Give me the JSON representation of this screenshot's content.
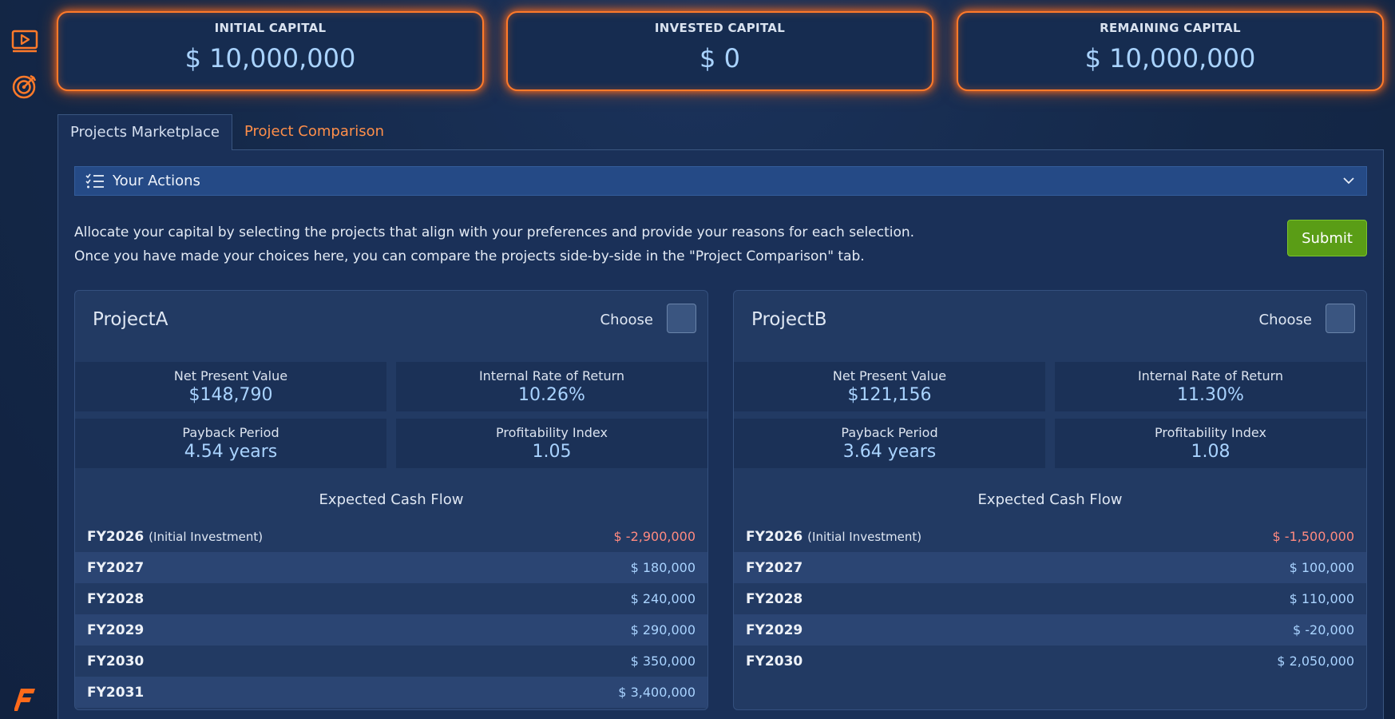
{
  "sidebar": {
    "icons": [
      "play-video-icon",
      "target-icon"
    ],
    "logo_icon": "brand-logo-icon"
  },
  "capital": {
    "initial": {
      "label": "INITIAL CAPITAL",
      "value": "$ 10,000,000"
    },
    "invested": {
      "label": "INVESTED CAPITAL",
      "value": "$ 0"
    },
    "remaining": {
      "label": "REMAINING CAPITAL",
      "value": "$ 10,000,000"
    }
  },
  "tabs": [
    {
      "label": "Projects Marketplace",
      "active": true
    },
    {
      "label": "Project Comparison",
      "active": false
    }
  ],
  "actions": {
    "label": "Your Actions",
    "icon": "checklist-icon",
    "toggle_icon": "chevron-down-icon"
  },
  "instructions": {
    "line1": "Allocate your capital by selecting the projects that align with your preferences and provide your reasons for each selection.",
    "line2": "Once you have made your choices here, you can compare the projects side-by-side in the \"Project Comparison\" tab."
  },
  "submit_label": "Submit",
  "projects": [
    {
      "name": "ProjectA",
      "choose_label": "Choose",
      "checked": false,
      "metrics": {
        "npv": {
          "label": "Net Present Value",
          "value": "$148,790"
        },
        "irr": {
          "label": "Internal Rate of Return",
          "value": "10.26%"
        },
        "payback": {
          "label": "Payback Period",
          "value": "4.54 years"
        },
        "pi": {
          "label": "Profitability Index",
          "value": "1.05"
        }
      },
      "cashflow_title": "Expected Cash Flow",
      "cashflow": [
        {
          "year": "FY2026",
          "note": "(Initial Investment)",
          "value": "$ -2,900,000"
        },
        {
          "year": "FY2027",
          "note": "",
          "value": "$ 180,000"
        },
        {
          "year": "FY2028",
          "note": "",
          "value": "$ 240,000"
        },
        {
          "year": "FY2029",
          "note": "",
          "value": "$ 290,000"
        },
        {
          "year": "FY2030",
          "note": "",
          "value": "$ 350,000"
        },
        {
          "year": "FY2031",
          "note": "",
          "value": "$ 3,400,000"
        }
      ]
    },
    {
      "name": "ProjectB",
      "choose_label": "Choose",
      "checked": false,
      "metrics": {
        "npv": {
          "label": "Net Present Value",
          "value": "$121,156"
        },
        "irr": {
          "label": "Internal Rate of Return",
          "value": "11.30%"
        },
        "payback": {
          "label": "Payback Period",
          "value": "3.64 years"
        },
        "pi": {
          "label": "Profitability Index",
          "value": "1.08"
        }
      },
      "cashflow_title": "Expected Cash Flow",
      "cashflow": [
        {
          "year": "FY2026",
          "note": "(Initial Investment)",
          "value": "$ -1,500,000"
        },
        {
          "year": "FY2027",
          "note": "",
          "value": "$ 100,000"
        },
        {
          "year": "FY2028",
          "note": "",
          "value": "$ 110,000"
        },
        {
          "year": "FY2029",
          "note": "",
          "value": "$ -20,000"
        },
        {
          "year": "FY2030",
          "note": "",
          "value": "$ 2,050,000"
        }
      ]
    }
  ],
  "colors": {
    "accent_orange": "#ff7a2a",
    "value_blue": "#a9d3ff",
    "negative_red": "#ff8a80",
    "submit_green": "#5a9d16",
    "background": "#14274a"
  }
}
